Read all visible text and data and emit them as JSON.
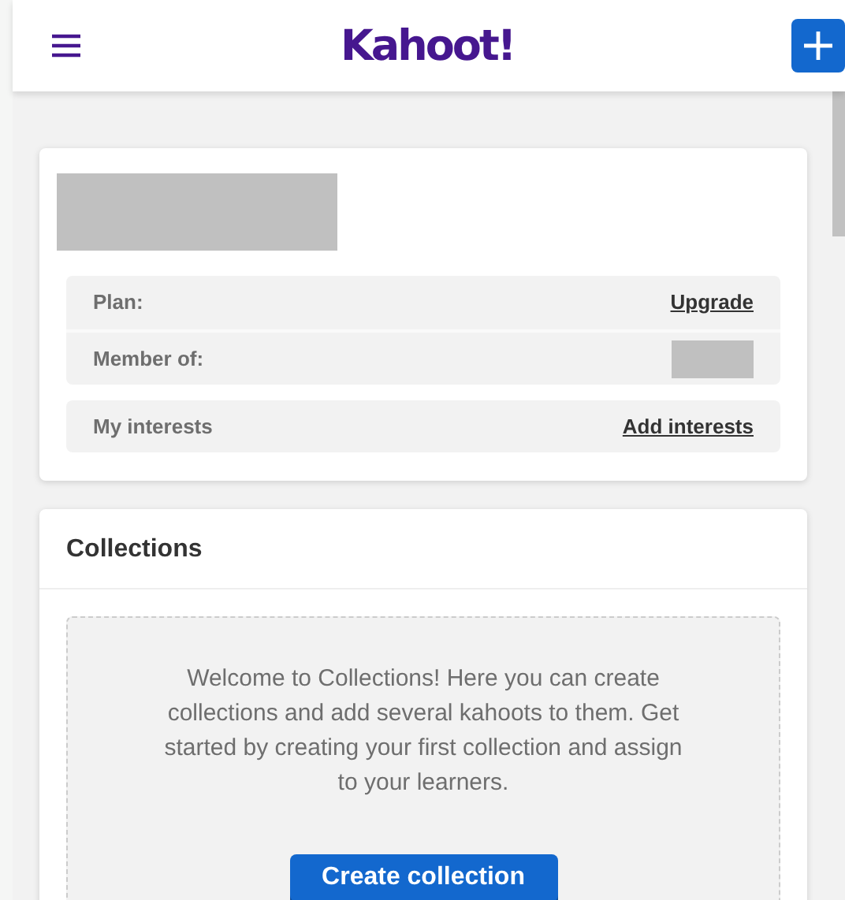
{
  "header": {
    "logo": "Kahoot!"
  },
  "profile": {
    "groups": [
      [
        {
          "label": "Plan:",
          "link": "Upgrade"
        },
        {
          "label": "Member of:"
        }
      ],
      [
        {
          "label": "My interests",
          "link": "Add interests"
        }
      ]
    ]
  },
  "collections": {
    "title": "Collections",
    "message": "Welcome to Collections! Here you can create collections and add several kahoots to them. Get started by creating your first collection and assign to your learners.",
    "button": "Create collection"
  }
}
